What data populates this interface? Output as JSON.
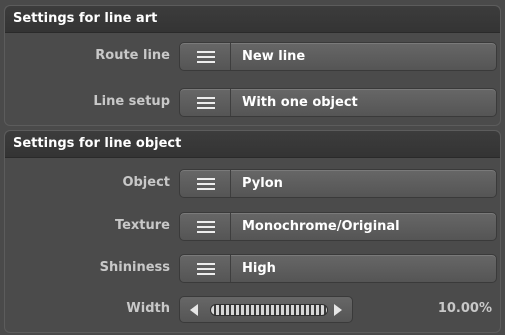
{
  "line_art": {
    "header": "Settings for line art",
    "rows": [
      {
        "label": "Route line",
        "value": "New line"
      },
      {
        "label": "Line setup",
        "value": "With one object"
      }
    ]
  },
  "line_object": {
    "header": "Settings for line object",
    "rows": [
      {
        "label": "Object",
        "value": "Pylon"
      },
      {
        "label": "Texture",
        "value": "Monochrome/Original"
      },
      {
        "label": "Shininess",
        "value": "High"
      }
    ],
    "width": {
      "label": "Width",
      "value_text": "10.00%",
      "value": 10.0
    }
  },
  "icons": {
    "dropdown_handle": "menu-icon",
    "slider_left": "arrow-left-icon",
    "slider_right": "arrow-right-icon"
  }
}
